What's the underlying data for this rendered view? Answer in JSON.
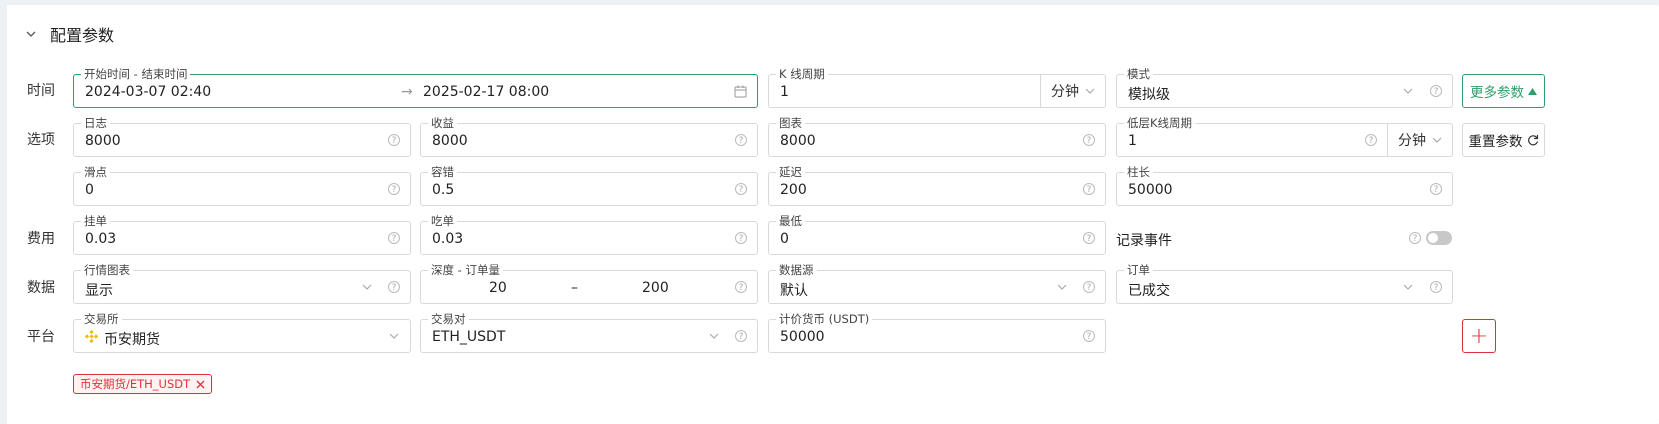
{
  "section": {
    "title": "配置参数"
  },
  "row_labels": {
    "time": "时间",
    "options": "选项",
    "fees": "费用",
    "data": "数据",
    "platform": "平台"
  },
  "time": {
    "range_label": "开始时间 - 结束时间",
    "start": "2024-03-07 02:40",
    "arrow": "→",
    "end": "2025-02-17 08:00",
    "kline_label": "K 线周期",
    "kline_value": "1",
    "kline_unit": "分钟",
    "mode_label": "模式",
    "mode_value": "模拟级",
    "more_button": "更多参数"
  },
  "options": {
    "log_label": "日志",
    "log_value": "8000",
    "profit_label": "收益",
    "profit_value": "8000",
    "chart_label": "图表",
    "chart_value": "8000",
    "low_kline_label": "低层K线周期",
    "low_kline_value": "1",
    "low_kline_unit": "分钟",
    "reset_button": "重置参数",
    "slippage_label": "滑点",
    "slippage_value": "0",
    "tolerance_label": "容错",
    "tolerance_value": "0.5",
    "delay_label": "延迟",
    "delay_value": "200",
    "bar_label": "柱长",
    "bar_value": "50000"
  },
  "fees": {
    "maker_label": "挂单",
    "maker_value": "0.03",
    "taker_label": "吃单",
    "taker_value": "0.03",
    "min_label": "最低",
    "min_value": "0",
    "record_events_label": "记录事件",
    "record_events_on": false
  },
  "data": {
    "market_chart_label": "行情图表",
    "market_chart_value": "显示",
    "depth_label": "深度 - 订单量",
    "depth_from": "20",
    "depth_sep": "–",
    "depth_to": "200",
    "source_label": "数据源",
    "source_value": "默认",
    "order_label": "订单",
    "order_value": "已成交"
  },
  "platform": {
    "exchange_label": "交易所",
    "exchange_value": "币安期货",
    "pair_label": "交易对",
    "pair_value": "ETH_USDT",
    "quote_label": "计价货币 (USDT)",
    "quote_value": "50000",
    "add_button": "+",
    "tag": "币安期货/ETH_USDT"
  },
  "help_glyph": "?",
  "colors": {
    "accent_green": "#2f9e6a",
    "accent_red": "#e0303c",
    "binance_yellow": "#f0b90b"
  }
}
